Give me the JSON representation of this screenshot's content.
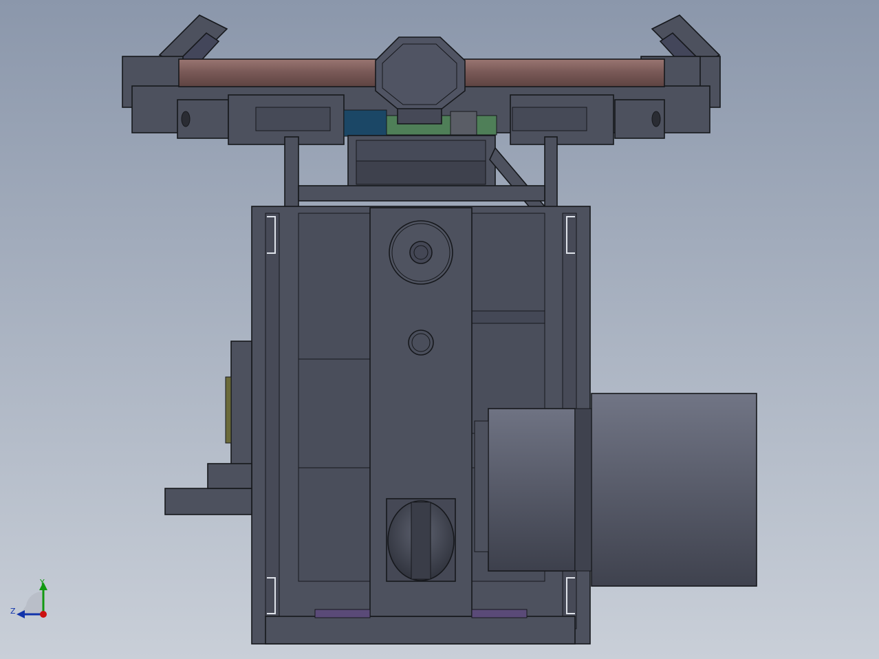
{
  "viewport": {
    "name": "CAD 3D viewport",
    "background_top": "#8b97ab",
    "background_bottom": "#c9cfd8"
  },
  "model": {
    "body_color": "#4d515e",
    "body_dark": "#3a3d48",
    "rod_color": "#7a5a58",
    "lens_color": "#5b5f6c",
    "pcb_green": "#4f7f58",
    "pcb_blue": "#1b4766",
    "pcb_purple": "#5a4a78"
  },
  "triad": {
    "x_color": "#cc1111",
    "y_color": "#119911",
    "z_color": "#1133aa",
    "y_label": "Y",
    "z_label": "Z"
  }
}
